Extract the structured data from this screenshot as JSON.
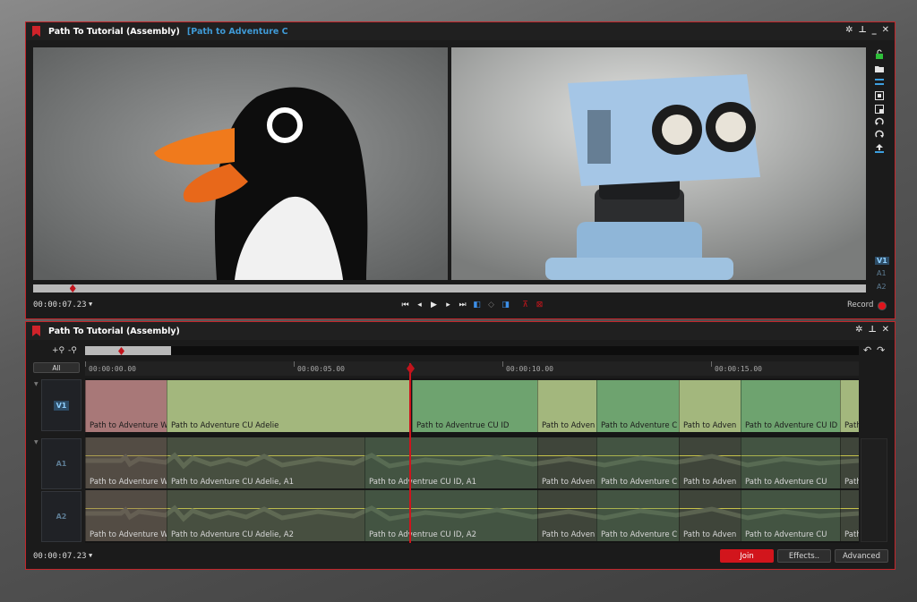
{
  "colors": {
    "accent": "#d2151c",
    "title_link": "#3f9ad6",
    "panel_border": "#c3262b"
  },
  "viewer": {
    "title": "Path To Tutorial (Assembly)",
    "subtitle": "[Path to Adventure C",
    "timecode": "00:00:07.23",
    "record_label": "Record",
    "track_labels": [
      "V1",
      "A1",
      "A2"
    ],
    "playhead_fraction": 0.047
  },
  "timeline": {
    "title": "Path To Tutorial (Assembly)",
    "all_label": "All",
    "timecode": "00:00:07.23",
    "ruler": [
      "00:00:00.00",
      "00:00:05.00",
      "00:00:10.00",
      "00:00:15.00"
    ],
    "v1_label": "V1",
    "a1_label": "A1",
    "a2_label": "A2",
    "video_clips": [
      "Path to Adventure W",
      "Path to Adventure CU Adelie",
      "Path to Adventrue CU ID",
      "Path to Adven",
      "Path to Adventure C",
      "Path to Adven",
      "Path to Adventure CU ID",
      "Path"
    ],
    "a1_clips": [
      "Path to Adventure W",
      "Path to Adventure CU Adelie, A1",
      "Path to Adventrue CU ID, A1",
      "Path to Adven",
      "Path to Adventure C",
      "Path to Adven",
      "Path to Adventure CU",
      "Path"
    ],
    "a2_clips": [
      "Path to Adventure W",
      "Path to Adventure CU Adelie, A2",
      "Path to Adventrue CU ID, A2",
      "Path to Adven",
      "Path to Adventure C",
      "Path to Adven",
      "Path to Adventure CU",
      "Path"
    ],
    "buttons": {
      "join": "Join",
      "effects": "Effects..",
      "advanced": "Advanced"
    }
  }
}
